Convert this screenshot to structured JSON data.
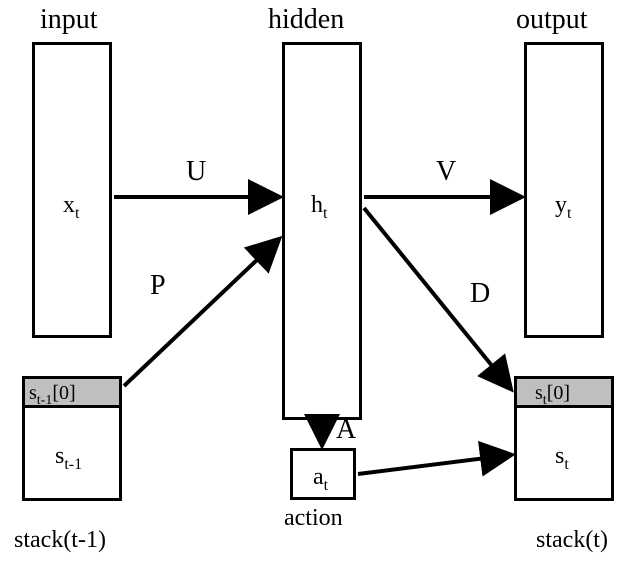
{
  "labels": {
    "input": "input",
    "hidden": "hidden",
    "output": "output",
    "action": "action",
    "stack_prev": "stack(t-1)",
    "stack_cur": "stack(t)"
  },
  "nodes": {
    "x": {
      "sym": "x",
      "sub": "t"
    },
    "h": {
      "sym": "h",
      "sub": "t"
    },
    "y": {
      "sym": "y",
      "sub": "t"
    },
    "a": {
      "sym": "a",
      "sub": "t"
    },
    "s_prev_top": {
      "sym": "s",
      "sub": "t-1",
      "idx": "[0]"
    },
    "s_prev": {
      "sym": "s",
      "sub": "t-1"
    },
    "s_cur_top": {
      "sym": "s",
      "sub": "t",
      "idx": "[0]"
    },
    "s_cur": {
      "sym": "s",
      "sub": "t"
    }
  },
  "edges": {
    "U": "U",
    "V": "V",
    "P": "P",
    "A": "A",
    "D": "D"
  }
}
